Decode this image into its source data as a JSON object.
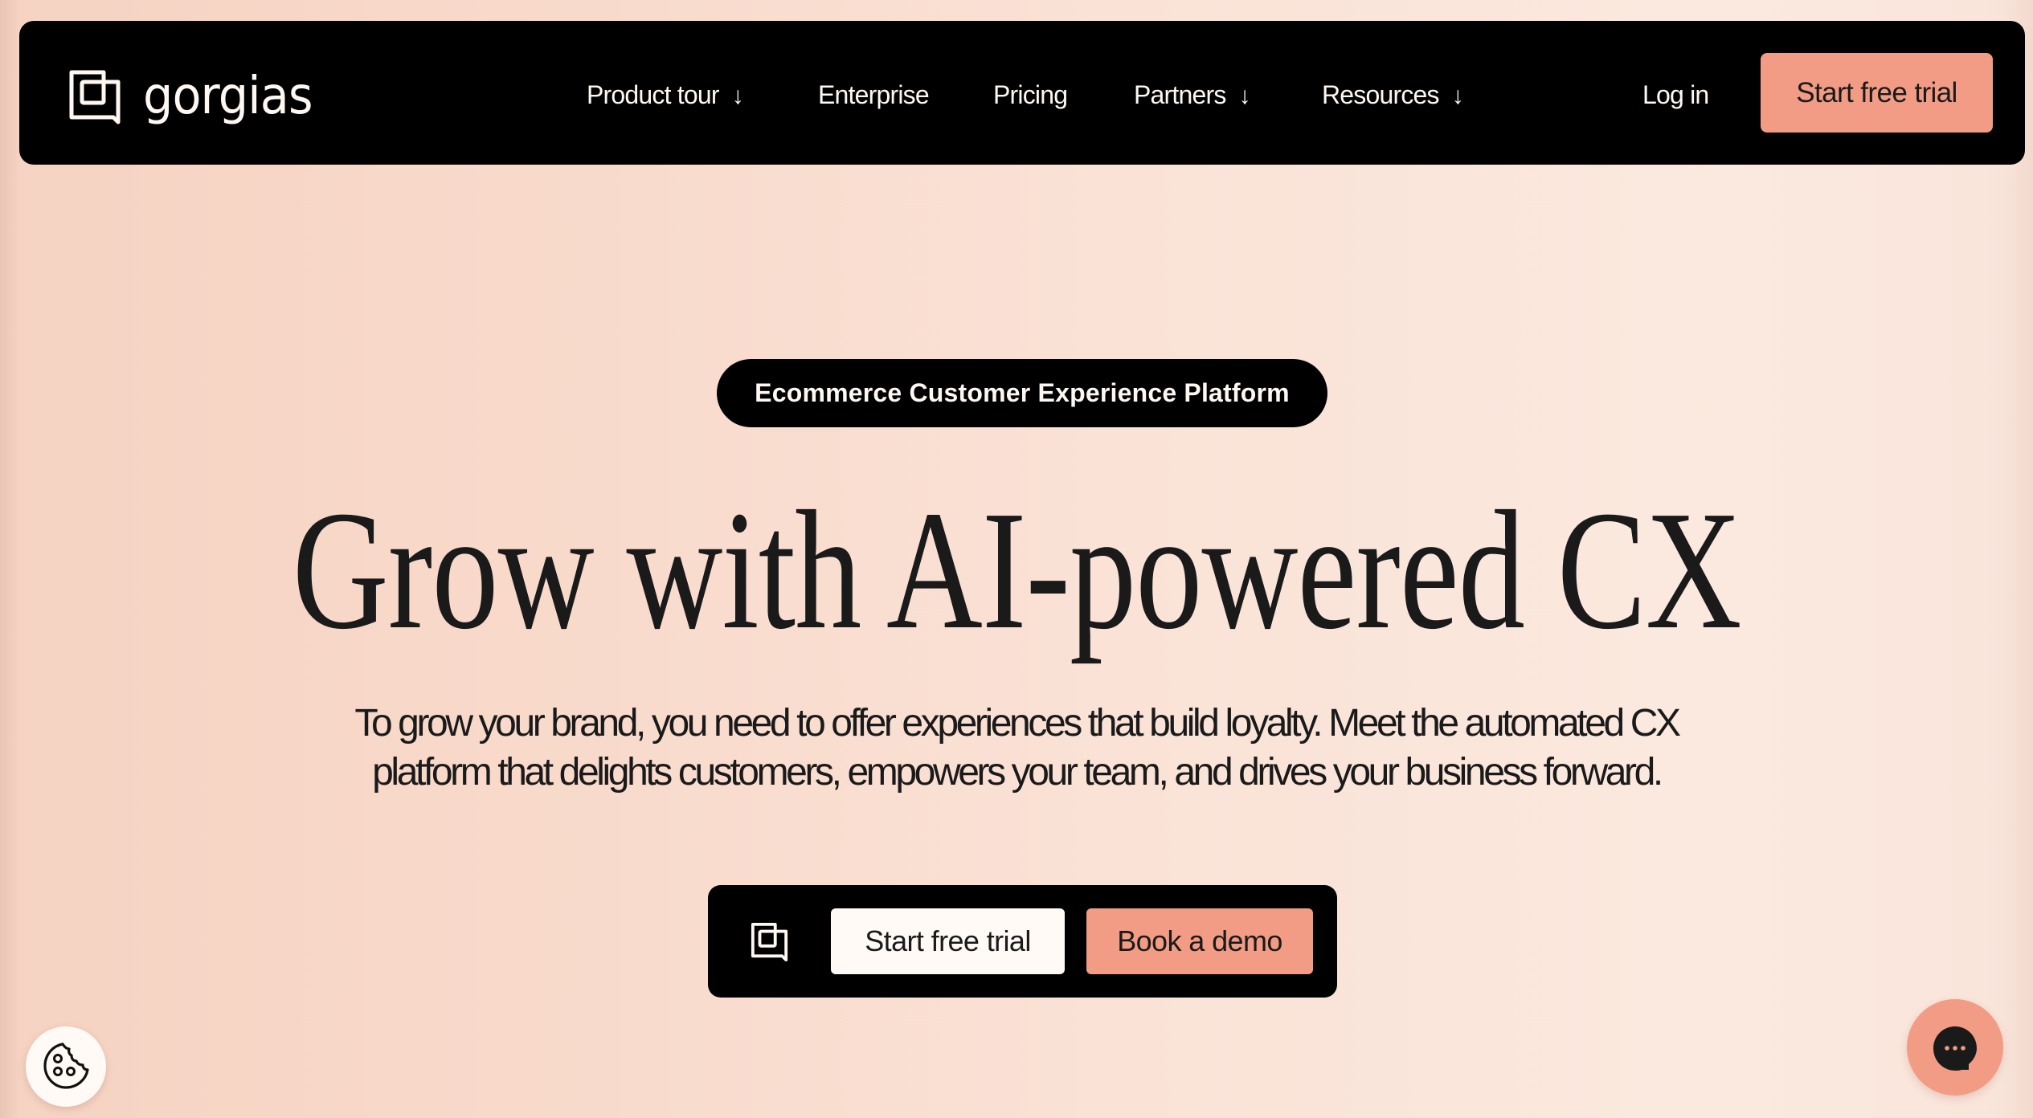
{
  "brand": {
    "name": "gorgias",
    "logo_icon": "gorgias-logo-icon"
  },
  "nav": {
    "items": [
      {
        "label": "Product tour",
        "has_dropdown": true,
        "icon": "arrow-down-icon",
        "arrow": "↓"
      },
      {
        "label": "Enterprise",
        "has_dropdown": false
      },
      {
        "label": "Pricing",
        "has_dropdown": false
      },
      {
        "label": "Partners",
        "has_dropdown": true,
        "icon": "arrow-down-icon",
        "arrow": "↓"
      },
      {
        "label": "Resources",
        "has_dropdown": true,
        "icon": "arrow-down-icon",
        "arrow": "↓"
      }
    ],
    "login_label": "Log in",
    "cta_label": "Start free trial"
  },
  "hero": {
    "badge": "Ecommerce Customer Experience Platform",
    "headline": "Grow with AI-powered CX",
    "subtitle_lines": [
      "To grow your brand, you need to offer experiences that build loyalty. Meet the automated CX",
      "platform that delights customers, empowers your team, and drives your business forward."
    ],
    "cta": {
      "icon": "gorgias-logo-icon",
      "primary_label": "Start free trial",
      "secondary_label": "Book a demo"
    }
  },
  "floating": {
    "cookie_icon": "cookie-icon",
    "chat_icon": "chat-bubble-icon"
  },
  "colors": {
    "accent": "#F29C85",
    "nav_bg": "#000000",
    "text": "#1A1A1A",
    "light_text": "#FFF8F2",
    "background_start": "#F6D3C3",
    "background_end": "#FBE9DF"
  }
}
